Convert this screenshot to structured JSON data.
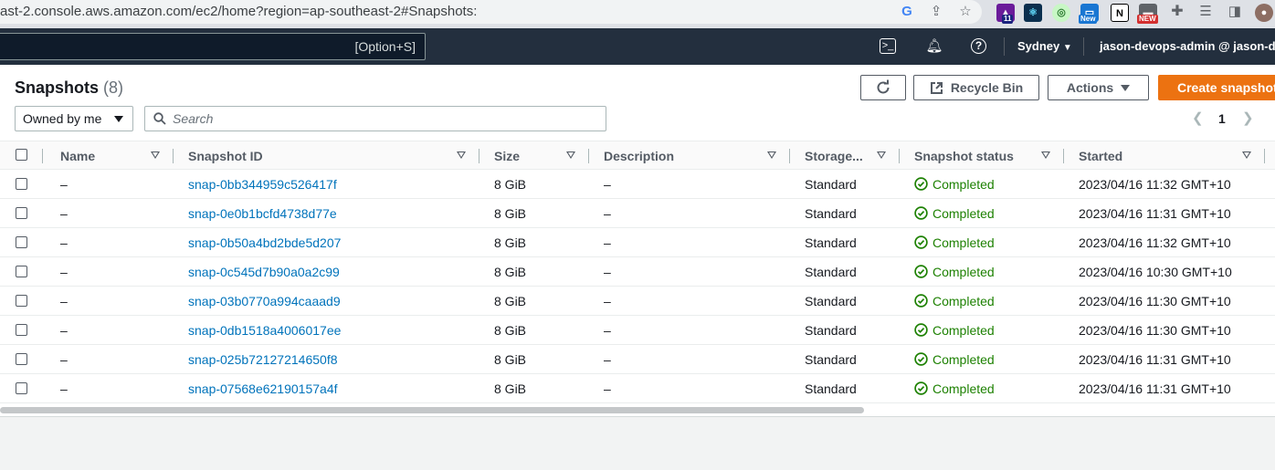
{
  "browser": {
    "url": "ast-2.console.aws.amazon.com/ec2/home?region=ap-southeast-2#Snapshots:",
    "ext_badge_count": "11",
    "ext_new_label": "New",
    "ext_new_label2": "NEW"
  },
  "topnav": {
    "search_shortcut": "[Option+S]",
    "region": "Sydney",
    "account": "jason-devops-admin @ jason-devop"
  },
  "header": {
    "title": "Snapshots",
    "count": "(8)",
    "recycle_bin_label": "Recycle Bin",
    "actions_label": "Actions",
    "create_label": "Create snapshot"
  },
  "filter": {
    "owner_select": "Owned by me",
    "search_placeholder": "Search"
  },
  "pagination": {
    "current_page": "1"
  },
  "table": {
    "columns": [
      "Name",
      "Snapshot ID",
      "Size",
      "Description",
      "Storage...",
      "Snapshot status",
      "Started"
    ],
    "rows": [
      {
        "name": "–",
        "id": "snap-0bb344959c526417f",
        "size": "8 GiB",
        "description": "–",
        "storage": "Standard",
        "status": "Completed",
        "started": "2023/04/16 11:32 GMT+10"
      },
      {
        "name": "–",
        "id": "snap-0e0b1bcfd4738d77e",
        "size": "8 GiB",
        "description": "–",
        "storage": "Standard",
        "status": "Completed",
        "started": "2023/04/16 11:31 GMT+10"
      },
      {
        "name": "–",
        "id": "snap-0b50a4bd2bde5d207",
        "size": "8 GiB",
        "description": "–",
        "storage": "Standard",
        "status": "Completed",
        "started": "2023/04/16 11:32 GMT+10"
      },
      {
        "name": "–",
        "id": "snap-0c545d7b90a0a2c99",
        "size": "8 GiB",
        "description": "–",
        "storage": "Standard",
        "status": "Completed",
        "started": "2023/04/16 10:30 GMT+10"
      },
      {
        "name": "–",
        "id": "snap-03b0770a994caaad9",
        "size": "8 GiB",
        "description": "–",
        "storage": "Standard",
        "status": "Completed",
        "started": "2023/04/16 11:30 GMT+10"
      },
      {
        "name": "–",
        "id": "snap-0db1518a4006017ee",
        "size": "8 GiB",
        "description": "–",
        "storage": "Standard",
        "status": "Completed",
        "started": "2023/04/16 11:30 GMT+10"
      },
      {
        "name": "–",
        "id": "snap-025b72127214650f8",
        "size": "8 GiB",
        "description": "–",
        "storage": "Standard",
        "status": "Completed",
        "started": "2023/04/16 11:31 GMT+10"
      },
      {
        "name": "–",
        "id": "snap-07568e62190157a4f",
        "size": "8 GiB",
        "description": "–",
        "storage": "Standard",
        "status": "Completed",
        "started": "2023/04/16 11:31 GMT+10"
      }
    ]
  },
  "colors": {
    "aws_nav": "#232f3e",
    "primary": "#ec7211",
    "link": "#0073bb",
    "success": "#1d8102"
  }
}
